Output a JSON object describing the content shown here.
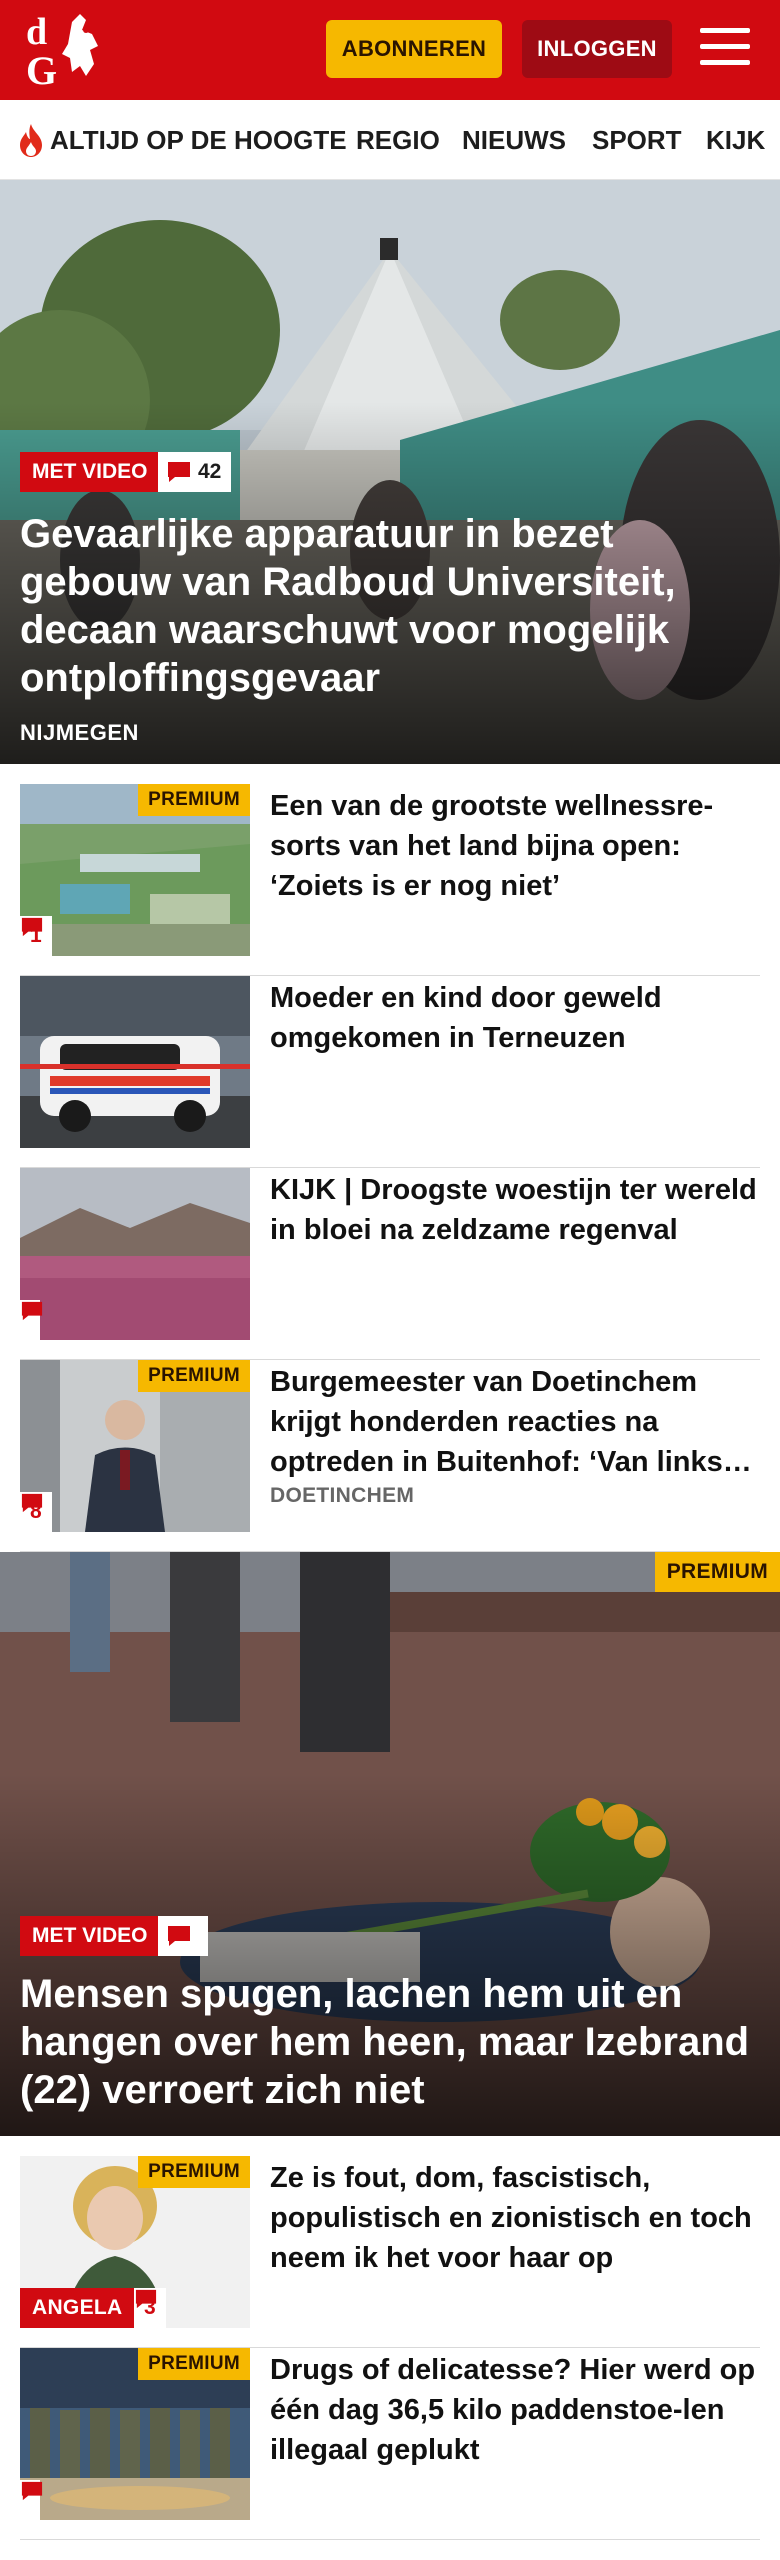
{
  "header": {
    "logo_text": "dG",
    "subscribe_label": "ABONNEREN",
    "login_label": "INLOGGEN",
    "brand_color": "#d10a11",
    "accent_color": "#f6b800"
  },
  "nav": {
    "items": [
      {
        "label": "ALTIJD OP DE HOOGTE",
        "icon": "flame-icon"
      },
      {
        "label": "REGIO"
      },
      {
        "label": "NIEUWS"
      },
      {
        "label": "SPORT"
      },
      {
        "label": "KIJK"
      }
    ]
  },
  "hero1": {
    "badge": "MET VIDEO",
    "comments": "42",
    "title": "Gevaarlijke apparatuur in bezet gebouw van Radboud Universiteit, decaan waarschuwt voor mogelijk ontploffingsgevaar",
    "kicker": "NIJMEGEN"
  },
  "list1": [
    {
      "premium": "PREMIUM",
      "comments": "1",
      "title": "Een van de grootste wellnessre-sorts van het land bijna open: ‘Zoiets is er nog niet’"
    },
    {
      "title": "Moeder en kind door geweld omgekomen in Terneuzen"
    },
    {
      "comments": "",
      "title": "KIJK | Droogste woestijn ter wereld in bloei na zeldzame regenval"
    },
    {
      "premium": "PREMIUM",
      "comments": "8",
      "title": "Burgemeester van Doetinchem krijgt honderden reacties na optreden in Buitenhof: ‘Van links tot rechts’",
      "kicker": "DOETINCHEM"
    }
  ],
  "hero2": {
    "premium": "PREMIUM",
    "badge": "MET VIDEO",
    "comments": "",
    "title": "Mensen spugen, lachen hem uit en hangen over hem heen, maar Izebrand (22) verroert zich niet"
  },
  "list2": [
    {
      "premium": "PREMIUM",
      "author": "ANGELA",
      "comments": "3",
      "title": "Ze is fout, dom, fascistisch, populistisch en zionistisch en toch neem ik het voor haar op"
    },
    {
      "premium": "PREMIUM",
      "comments": "",
      "title": "Drugs of delicatesse? Hier werd op één dag 36,5 kilo paddenstoe-len illegaal geplukt"
    }
  ]
}
